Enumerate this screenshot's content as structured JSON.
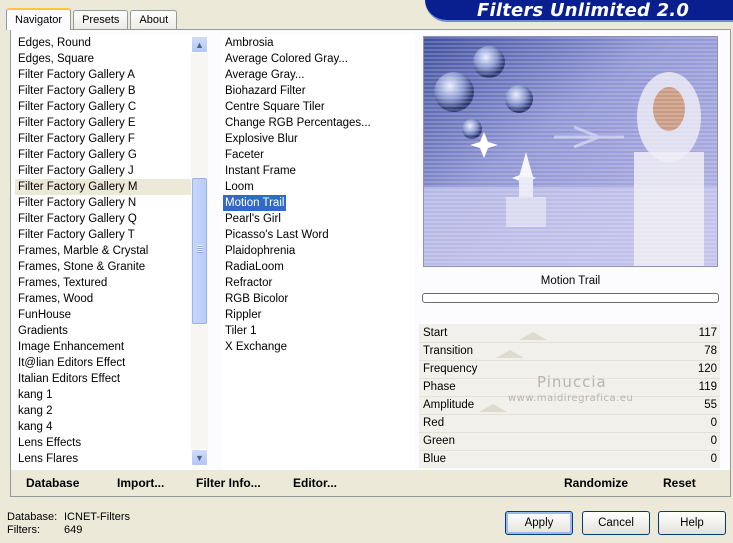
{
  "tabs": [
    "Navigator",
    "Presets",
    "About"
  ],
  "banner_title": "Filters Unlimited 2.0",
  "categories": [
    "Edges, Round",
    "Edges, Square",
    "Filter Factory Gallery A",
    "Filter Factory Gallery B",
    "Filter Factory Gallery C",
    "Filter Factory Gallery E",
    "Filter Factory Gallery F",
    "Filter Factory Gallery G",
    "Filter Factory Gallery J",
    "Filter Factory Gallery M",
    "Filter Factory Gallery N",
    "Filter Factory Gallery Q",
    "Filter Factory Gallery T",
    "Frames, Marble & Crystal",
    "Frames, Stone & Granite",
    "Frames, Textured",
    "Frames, Wood",
    "FunHouse",
    "Gradients",
    "Image Enhancement",
    "It@lian Editors Effect",
    "Italian Editors Effect",
    "kang 1",
    "kang 2",
    "kang 4",
    "Lens Effects",
    "Lens Flares"
  ],
  "selected_category": "Filter Factory Gallery M",
  "filters": [
    "Ambrosia",
    "Average Colored Gray...",
    "Average Gray...",
    "Biohazard Filter",
    "Centre Square Tiler",
    "Change RGB Percentages...",
    "Explosive Blur",
    "Faceter",
    "Instant Frame",
    "Loom",
    "Motion Trail",
    "Pearl's Girl",
    "Picasso's Last Word",
    "Plaidophrenia",
    "RadiaLoom",
    "Refractor",
    "RGB Bicolor",
    "Rippler",
    "Tiler 1",
    "X Exchange"
  ],
  "selected_filter": "Motion Trail",
  "preview_name": "Motion Trail",
  "params": [
    {
      "label": "Start",
      "value": "117"
    },
    {
      "label": "Transition",
      "value": "78"
    },
    {
      "label": "Frequency",
      "value": "120"
    },
    {
      "label": "Phase",
      "value": "119"
    },
    {
      "label": "Amplitude",
      "value": "55"
    },
    {
      "label": "Red",
      "value": "0"
    },
    {
      "label": "Green",
      "value": "0"
    },
    {
      "label": "Blue",
      "value": "0"
    }
  ],
  "watermark": {
    "name": "Pinuccia",
    "site": "www.maidiregrafica.eu"
  },
  "bottom_links": {
    "database": "Database",
    "import": "Import...",
    "filter_info": "Filter Info...",
    "editor": "Editor...",
    "randomize": "Randomize",
    "reset": "Reset"
  },
  "footer": {
    "database_label": "Database:",
    "database_value": "ICNET-Filters",
    "filters_label": "Filters:",
    "filters_value": "649"
  },
  "buttons": {
    "apply": "Apply",
    "cancel": "Cancel",
    "help": "Help"
  },
  "colors": {
    "banner": "#0a1f8f",
    "selection": "#316ac5",
    "tab_accent": "#ffc83c"
  }
}
